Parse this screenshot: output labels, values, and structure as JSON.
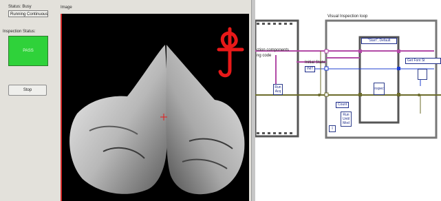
{
  "front_panel": {
    "status_label": "Status: Busy",
    "status_value": "Running Continuously",
    "image_label": "Image",
    "inspection_status_label": "Inspection Status:",
    "led_text": "PASS",
    "stop_label": "Stop",
    "led_color": "#2fd23a",
    "overlay_color": "#e81919"
  },
  "block_diagram": {
    "loop_label": "Visual Inspection loop",
    "left_label_line1": "ction components",
    "left_label_line2": "ng code",
    "initial_state_label": "Initial State",
    "init_const": "INIT",
    "case_selector": "\"Start\", Default",
    "shift_const": "Count",
    "subvi_left": "Run Acq",
    "subvi_case": "Inspect",
    "subvi_bottom": "Run Until Mod",
    "property_node": "Get Font St",
    "loop_index": "i"
  }
}
